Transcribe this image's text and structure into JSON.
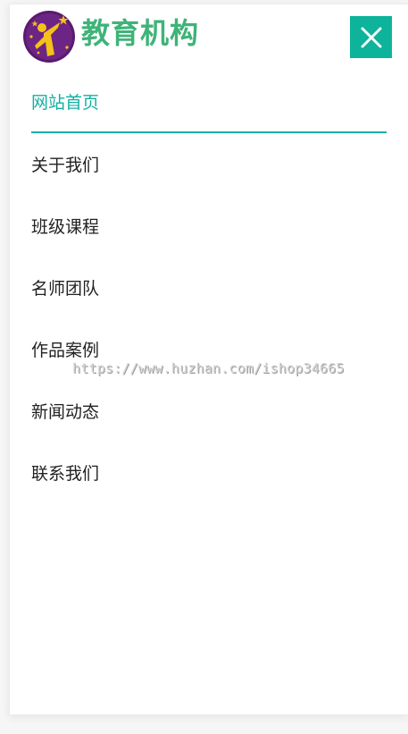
{
  "brand": {
    "name": "教育机构",
    "color": "#3fb378"
  },
  "header": {
    "close_icon": "close-icon",
    "close_color": "#0db39a"
  },
  "nav": {
    "active_color": "#12b0a3",
    "items": [
      {
        "label": "网站首页",
        "active": true
      },
      {
        "label": "关于我们",
        "active": false
      },
      {
        "label": "班级课程",
        "active": false
      },
      {
        "label": "名师团队",
        "active": false
      },
      {
        "label": "作品案例",
        "active": false
      },
      {
        "label": "新闻动态",
        "active": false
      },
      {
        "label": "联系我们",
        "active": false
      }
    ]
  },
  "watermark": "https://www.huzhan.com/ishop34665"
}
